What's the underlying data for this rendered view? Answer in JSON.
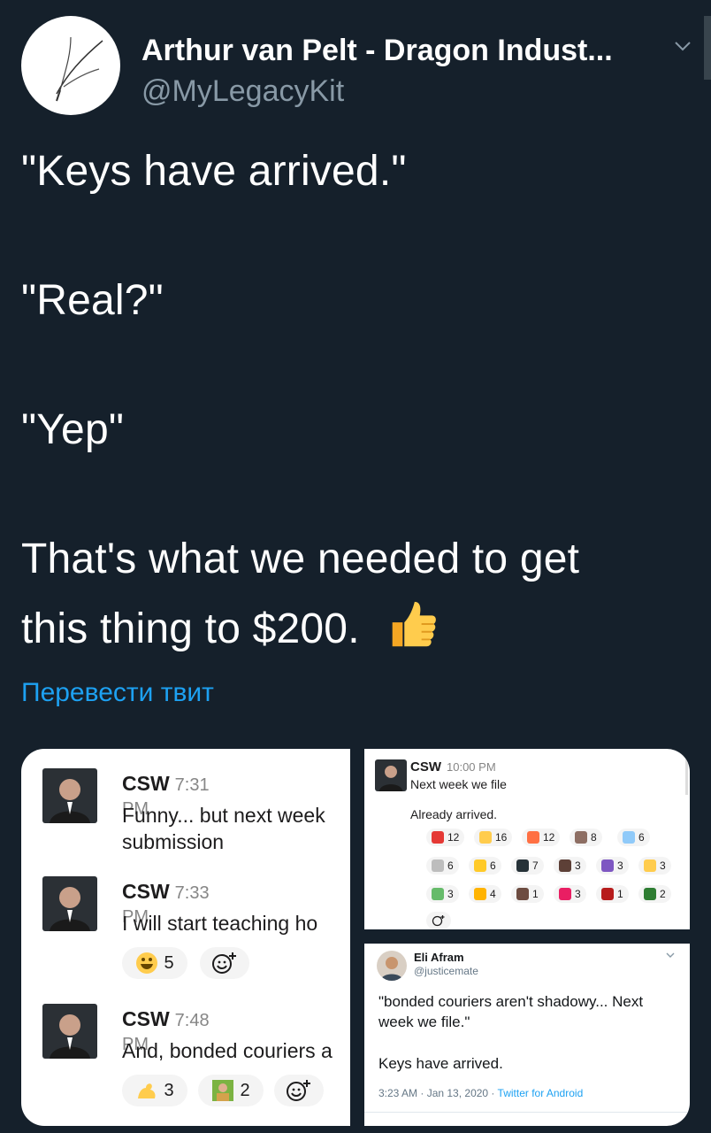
{
  "header": {
    "display_name": "Arthur van Pelt - Dragon Indust...",
    "handle": "@MyLegacyKit"
  },
  "tweet": {
    "lines": [
      "\"Keys have arrived.\"",
      "\"Real?\"",
      "\"Yep\"",
      "That's what we needed to get",
      "this thing to $200."
    ],
    "translate_label": "Перевести твит"
  },
  "slack_left": {
    "messages": [
      {
        "author": "CSW",
        "time": "7:31 PM",
        "lines": [
          "Funny... but next week",
          "submission"
        ]
      },
      {
        "author": "CSW",
        "time": "7:33 PM",
        "lines": [
          "I will start teaching ho"
        ]
      },
      {
        "author": "CSW",
        "time": "7:48 PM",
        "lines": [
          "And, bonded couriers a"
        ]
      }
    ],
    "reactions_msg2": [
      {
        "emoji": "laughing-face",
        "count": "5"
      }
    ],
    "reactions_msg3": [
      {
        "emoji": "flexed-biceps",
        "count": "3"
      },
      {
        "emoji": "person-image",
        "count": "2"
      }
    ]
  },
  "slack_right": {
    "author": "CSW",
    "time": "10:00 PM",
    "line1": "Next week we file",
    "line2": "Already arrived.",
    "reaction_rows": [
      [
        {
          "emoji": "hundred",
          "count": "12"
        },
        {
          "emoji": "thumbs-up",
          "count": "16"
        },
        {
          "emoji": "fire",
          "count": "12"
        },
        {
          "emoji": "person-image",
          "count": "8"
        },
        {
          "emoji": "syringe",
          "count": "6"
        }
      ],
      [
        {
          "emoji": "key",
          "count": "6"
        },
        {
          "emoji": "bell",
          "count": "6"
        },
        {
          "emoji": "qr-image",
          "count": "7"
        },
        {
          "emoji": "mask",
          "count": "3"
        },
        {
          "emoji": "crab",
          "count": "3"
        },
        {
          "emoji": "flexed-biceps",
          "count": "3"
        }
      ],
      [
        {
          "emoji": "bottle",
          "count": "3"
        },
        {
          "emoji": "fist",
          "count": "4"
        },
        {
          "emoji": "game-image",
          "count": "1"
        },
        {
          "emoji": "rose",
          "count": "3"
        },
        {
          "emoji": "red-box",
          "count": "1"
        },
        {
          "emoji": "green-image",
          "count": "2"
        }
      ]
    ]
  },
  "embedded_tweet": {
    "name": "Eli Afram",
    "handle": "@justicemate",
    "text_lines": [
      "\"bonded couriers aren't shadowy... Next",
      "week we file.\""
    ],
    "text2": "Keys have arrived.",
    "time": "3:23 AM · Jan 13, 2020 · ",
    "source": "Twitter for Android"
  },
  "colors": {
    "background": "#15202b",
    "link": "#1da1f2",
    "muted": "#8899a6"
  }
}
